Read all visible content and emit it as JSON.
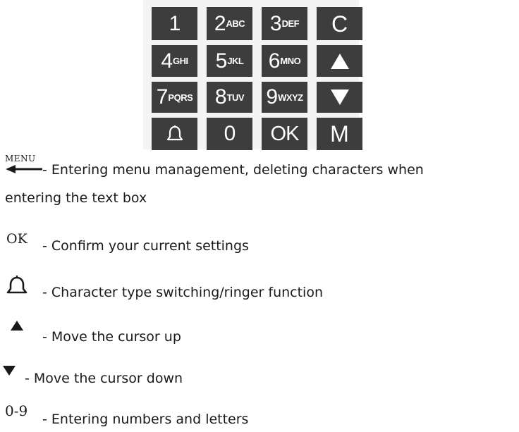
{
  "keypad": {
    "keys": [
      {
        "num": "1",
        "letters": ""
      },
      {
        "num": "2",
        "letters": "ABC"
      },
      {
        "num": "3",
        "letters": "DEF"
      },
      {
        "label": "C"
      },
      {
        "num": "4",
        "letters": "GHI"
      },
      {
        "num": "5",
        "letters": "JKL"
      },
      {
        "num": "6",
        "letters": "MNO"
      },
      {
        "icon": "triangle-up-icon"
      },
      {
        "num": "7",
        "letters": "PQRS"
      },
      {
        "num": "8",
        "letters": "TUV"
      },
      {
        "num": "9",
        "letters": "WXYZ"
      },
      {
        "icon": "triangle-down-icon"
      },
      {
        "icon": "bell-icon"
      },
      {
        "label": "0"
      },
      {
        "label": "OK"
      },
      {
        "label": "M"
      }
    ]
  },
  "legend": {
    "menu": {
      "label": "MENU",
      "icon": "arrow-left-icon",
      "line1": "- Entering menu management, deleting characters when",
      "line2": "entering the text box"
    },
    "ok": {
      "label": "OK",
      "text": "- Confirm your current settings"
    },
    "bell": {
      "icon": "bell-icon",
      "text": "- Character type switching/ringer function"
    },
    "up": {
      "icon": "triangle-up-icon",
      "text": "- Move the cursor up"
    },
    "down": {
      "icon": "triangle-down-icon",
      "text": "- Move the cursor down"
    },
    "digits": {
      "label": "0-9",
      "text": "- Entering numbers and letters"
    }
  },
  "colors": {
    "key_background": "#3d3d3d",
    "key_text": "#ffffff",
    "keypad_panel": "#f4f4f4",
    "text": "#1a1a1a"
  }
}
